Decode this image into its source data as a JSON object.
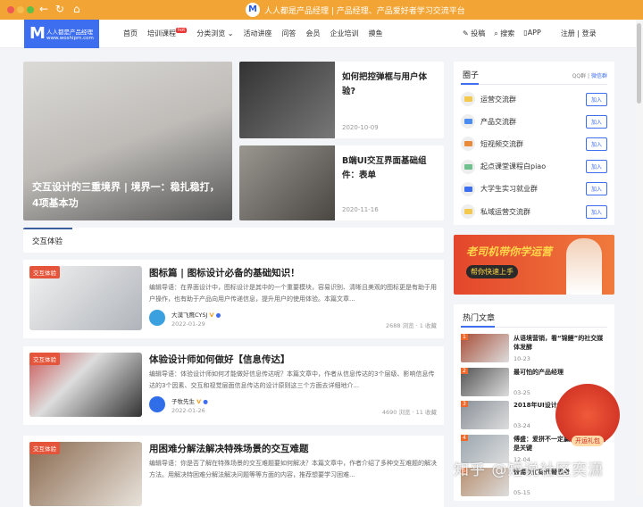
{
  "window": {
    "title": "人人都是产品经理 | 产品经理、产品爱好者学习交流平台"
  },
  "brand": {
    "name": "人人都是产品经理",
    "url": "www.woshipm.com",
    "mark": "M"
  },
  "nav": {
    "items": [
      "首页",
      "培训课程",
      "分类浏览",
      "活动讲座",
      "问答",
      "会员",
      "企业培训",
      "摸鱼"
    ],
    "hot": "hot",
    "post": "投稿",
    "search": "搜索",
    "app": "APP",
    "register": "注册",
    "login": "登录"
  },
  "hero": {
    "title": "交互设计的三重境界 | 境界一：稳扎稳打，4项基本功"
  },
  "features": [
    {
      "title": "如何把控弹框与用户体验?",
      "date": "2020-10-09"
    },
    {
      "title": "B端UI交互界面基础组件：表单",
      "date": "2020-11-16"
    }
  ],
  "section": {
    "tab": "交互体验"
  },
  "articles": [
    {
      "badge": "交互体验",
      "title": "图标篇 | 图标设计必备的基础知识！",
      "summary": "编辑导语：在界面设计中，图标设计是其中的一个重要模块，容易识别、清晰且美观的图标更是有助于用户操作，也有助于产品向用户传递信息，提升用户的使用体验。本篇文章...",
      "author": "大漠飞鹰CYSJ",
      "date": "2022-01-29",
      "stats": "2688 浏览 · 1 收藏"
    },
    {
      "badge": "交互体验",
      "title": "体验设计师如何做好【信息传达】",
      "summary": "编辑导语：体验设计师如何才能做好信息传达呢？本篇文章中，作者从信息传达的3个层级、影响信息传达的3个因素、交互和视觉层面信息传达的设计原则这三个方面去详细地介...",
      "author": "子牧先生",
      "date": "2022-01-26",
      "stats": "4690 浏览 · 11 收藏"
    },
    {
      "badge": "交互体验",
      "title": "用困难分解法解决特殊场景的交互难题",
      "summary": "编辑导语：你是否了解在特殊场景的交互难题要如何解决？本篇文章中，作者介绍了多种交互难题的解决方法。用解决特困难分解法解决问题等等方面的内容，推荐想要学习困难..."
    }
  ],
  "circles": {
    "title": "圈子",
    "qq": "QQ群",
    "wechat": "微信群",
    "join": "加入",
    "groups": [
      {
        "name": "运营交流群",
        "color": "#f2c94c"
      },
      {
        "name": "产品交流群",
        "color": "#4a8cf0"
      },
      {
        "name": "短视频交流群",
        "color": "#e88a3a"
      },
      {
        "name": "起点课堂课程白piao",
        "color": "#6fbf8f"
      },
      {
        "name": "大学生实习就业群",
        "color": "#3d6ef0"
      },
      {
        "name": "私域运营交流群",
        "color": "#f2c94c"
      }
    ]
  },
  "ad": {
    "headline": "老司机带你学运营",
    "sub": "帮你快速上手"
  },
  "hot": {
    "title": "热门文章",
    "items": [
      {
        "rank": "1",
        "title": "从语境营销，看“锦鲤”的社交媒体发酵",
        "date": "10-23"
      },
      {
        "rank": "2",
        "title": "最可怕的产品经理",
        "date": "03-25"
      },
      {
        "rank": "3",
        "title": "2018年UI设计的9",
        "date": "03-24"
      },
      {
        "rank": "4",
        "title": "傅盛：爱拼不一定赢，认知格局才是关键",
        "date": "12-04"
      },
      {
        "rank": "5",
        "title": "警惕以忙碌代替思考",
        "date": "05-15"
      }
    ]
  },
  "promo": {
    "label": "开运礼包"
  },
  "watermark": "知乎 @短说社区奕潇"
}
